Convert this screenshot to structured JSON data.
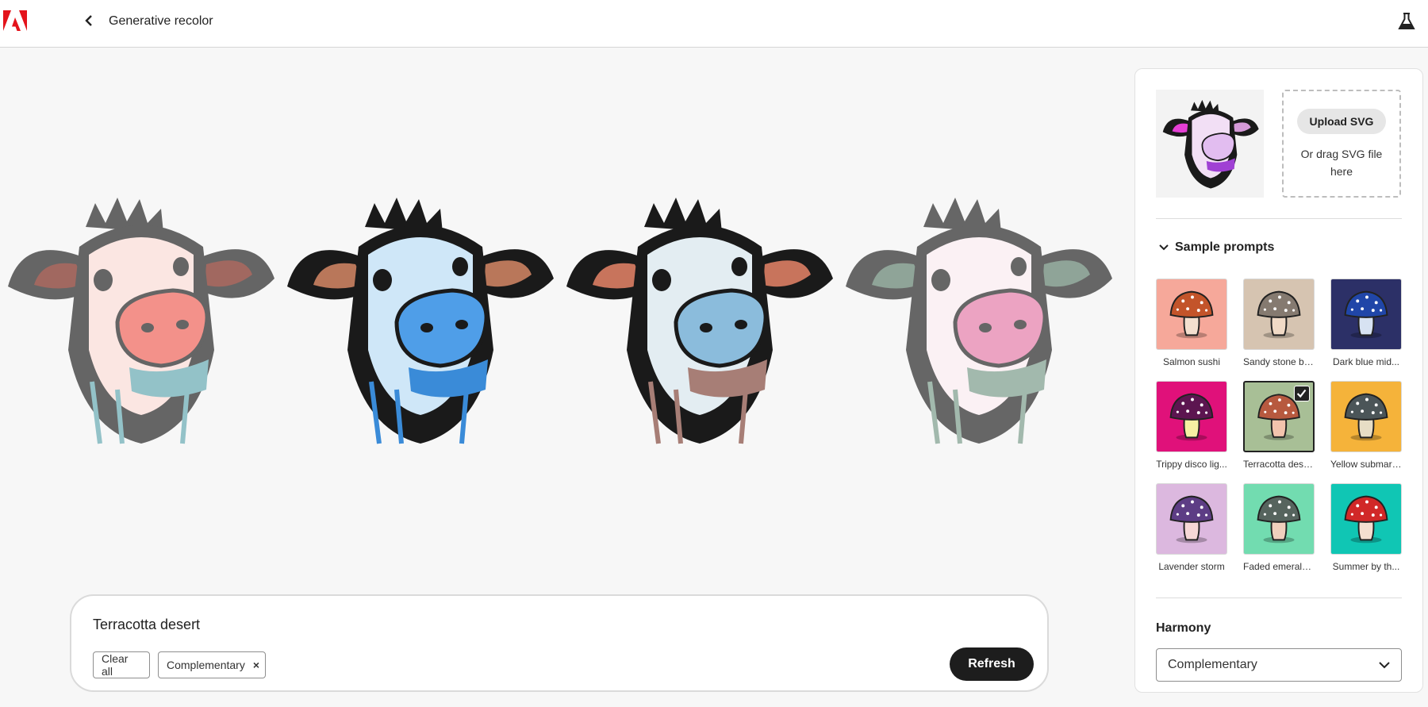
{
  "header": {
    "logo": "adobe-logo",
    "back_icon": "chevron-left-icon",
    "title": "Generative recolor",
    "lab_icon": "flask-icon"
  },
  "canvas": {
    "variants": [
      {
        "name": "variant-1",
        "face": "#fbe6e2",
        "ear": "#a16860",
        "snout": "#f3918a",
        "dark": "#656565",
        "accent": "#93c2c8"
      },
      {
        "name": "variant-2",
        "face": "#cfe7f8",
        "ear": "#b9775a",
        "snout": "#4f9ee8",
        "dark": "#1a1a1a",
        "accent": "#3a8bd8"
      },
      {
        "name": "variant-3",
        "face": "#e3edf2",
        "ear": "#c8745c",
        "snout": "#8bbcdc",
        "dark": "#1a1a1a",
        "accent": "#a77e76"
      },
      {
        "name": "variant-4",
        "face": "#fbf1f4",
        "ear": "#8fa498",
        "snout": "#eca3c2",
        "dark": "#666666",
        "accent": "#a2b9ad"
      }
    ]
  },
  "prompt": {
    "text": "Terracotta desert",
    "clear_label": "Clear all",
    "chip_label": "Complementary",
    "chip_remove": "×",
    "refresh_label": "Refresh"
  },
  "panel": {
    "upload_label": "Upload SVG",
    "upload_hint": "Or drag SVG file here",
    "sample_heading": "Sample prompts",
    "samples": [
      {
        "label": "Salmon sushi",
        "bg": "#f6a89a",
        "cap": "#c3542a",
        "stem": "#f3dfcf"
      },
      {
        "label": "Sandy stone be...",
        "bg": "#d6c4b1",
        "cap": "#857a70",
        "stem": "#f0dac6"
      },
      {
        "label": "Dark blue mid...",
        "bg": "#2c3067",
        "cap": "#2046a8",
        "stem": "#d7e2f2"
      },
      {
        "label": "Trippy disco lig...",
        "bg": "#e0117a",
        "cap": "#5c1550",
        "stem": "#f6f0a2"
      },
      {
        "label": "Terracotta desert",
        "bg": "#a8bf96",
        "cap": "#b7593f",
        "stem": "#f3c3ad",
        "selected": true
      },
      {
        "label": "Yellow submari...",
        "bg": "#f5b33a",
        "cap": "#4b5558",
        "stem": "#e7ddc5"
      },
      {
        "label": "Lavender storm",
        "bg": "#dcb8df",
        "cap": "#5d3d85",
        "stem": "#f6d8d6"
      },
      {
        "label": "Faded emerald...",
        "bg": "#72dcb0",
        "cap": "#56645e",
        "stem": "#f0cfbd"
      },
      {
        "label": "Summer by th...",
        "bg": "#10c6b4",
        "cap": "#d12828",
        "stem": "#f5ded0"
      }
    ],
    "harmony_label": "Harmony",
    "harmony_value": "Complementary"
  }
}
